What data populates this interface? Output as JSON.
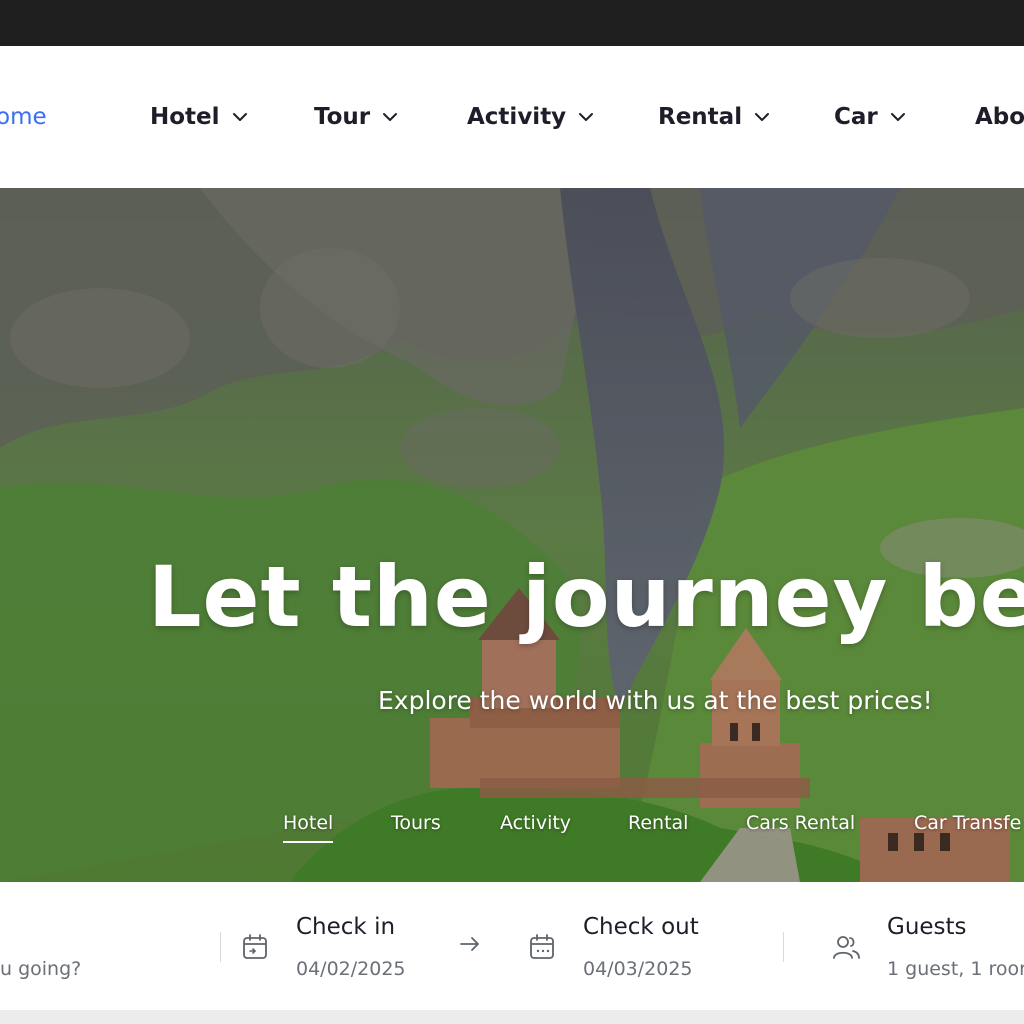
{
  "nav": {
    "items": [
      {
        "label": "ome",
        "active": true
      },
      {
        "label": "Hotel"
      },
      {
        "label": "Tour"
      },
      {
        "label": "Activity"
      },
      {
        "label": "Rental"
      },
      {
        "label": "Car"
      },
      {
        "label": "Abo"
      }
    ],
    "active_color": "#3b6ef5"
  },
  "hero": {
    "title": "Let the journey be",
    "subtitle": "Explore the world with us at the best prices!",
    "tabs": [
      "Hotel",
      "Tours",
      "Activity",
      "Rental",
      "Cars Rental",
      "Car Transfe"
    ]
  },
  "search": {
    "where_placeholder": "u going?",
    "check_in_label": "Check in",
    "check_in_value": "04/02/2025",
    "check_out_label": "Check out",
    "check_out_value": "04/03/2025",
    "guests_label": "Guests",
    "guests_value": "1 guest, 1 roor"
  },
  "icons": {
    "check_in": "calendar-icon",
    "check_out": "calendar-icon",
    "arrow": "arrow-right-icon",
    "guests": "users-icon",
    "chevron": "chevron-down-icon"
  }
}
